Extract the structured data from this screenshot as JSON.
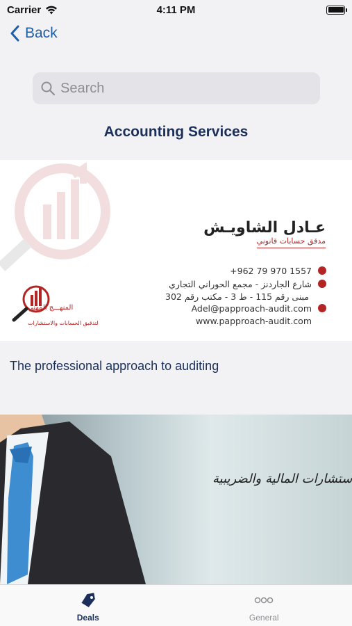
{
  "status_bar": {
    "carrier": "Carrier",
    "time": "4:11 PM"
  },
  "nav": {
    "back_label": "Back"
  },
  "search": {
    "placeholder": "Search"
  },
  "page_title": "Accounting Services",
  "card": {
    "name": "عـادل الشاويـش",
    "role": "مدقق حسابات قانوني",
    "phone": "+962 79 970 1557",
    "street": "شارع الجاردنز - مجمع الحوراني التجاري",
    "building": "مبنى رقم 115 - ط 3 - مكتب رقم 302",
    "email": "Adel@papproach-audit.com",
    "website": "www.papproach-audit.com",
    "logo_name": "المنهـــج المهني",
    "logo_tagline": "لتدقيق الحسابات والاستشارات"
  },
  "description": "The professional approach to auditing",
  "banner": {
    "text": "الاستشارات المالية والضريبية"
  },
  "tabs": [
    {
      "label": "Deals",
      "active": true
    },
    {
      "label": "General",
      "active": false
    }
  ],
  "colors": {
    "accent": "#1f5fa8",
    "title": "#1b2f5a",
    "brand_red": "#b32424"
  },
  "status_bar_battery_level": 1.0
}
